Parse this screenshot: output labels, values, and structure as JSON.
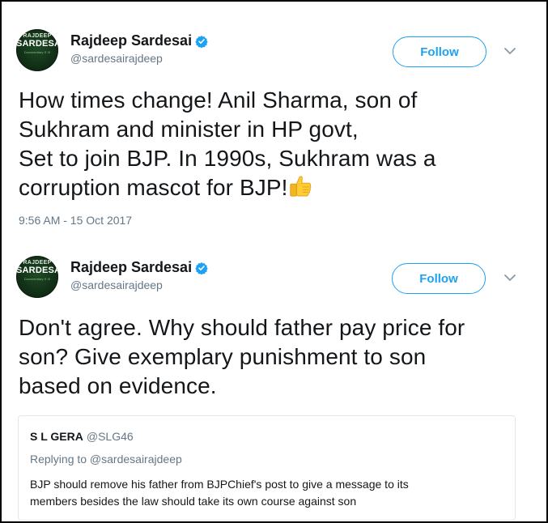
{
  "tweets": [
    {
      "author": {
        "name": "Rajdeep Sardesai",
        "handle": "@sardesairajdeep",
        "avatar_text": {
          "top": "RAJDEEP",
          "middle": "SARDESAI",
          "bottom": "Documentary S XI"
        },
        "verified": true
      },
      "follow_label": "Follow",
      "text_lines": [
        "How times change! Anil Sharma, son of",
        "Sukhram and minister in HP govt,",
        "Set to join BJP. In 1990s, Sukhram was a",
        "corruption mascot for BJP!"
      ],
      "emoji": "thumbs-up",
      "timestamp": "9:56 AM - 15 Oct 2017"
    },
    {
      "author": {
        "name": "Rajdeep Sardesai",
        "handle": "@sardesairajdeep",
        "avatar_text": {
          "top": "RAJDEEP",
          "middle": "SARDESAI",
          "bottom": "Documentary S XI"
        },
        "verified": true
      },
      "follow_label": "Follow",
      "text_lines": [
        "Don't agree. Why should father pay price for",
        "son? Give exemplary punishment to son",
        "based on evidence."
      ],
      "quoted": {
        "name": "S L GERA",
        "handle": "@SLG46",
        "replying_to": "Replying to @sardesairajdeep",
        "text_lines": [
          "BJP should remove his father from BJPChief's post to give a message to its",
          "members besides the law should take its own course against son"
        ]
      }
    }
  ],
  "colors": {
    "accent": "#1da1f2",
    "text": "#14171a",
    "muted": "#657786",
    "border": "#e1e8ed",
    "frame": "#000000"
  },
  "icons": {
    "verified": "verified-badge-icon",
    "caret": "chevron-down-icon",
    "emoji": "thumbs-up-emoji-icon"
  }
}
